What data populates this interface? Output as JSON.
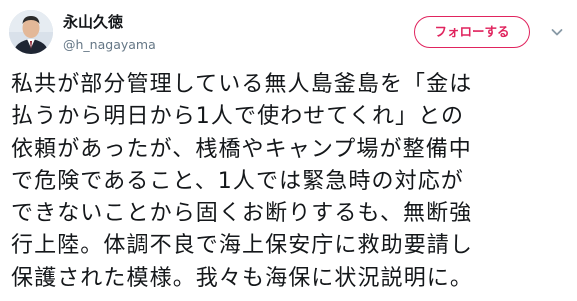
{
  "user": {
    "display_name": "永山久徳",
    "handle": "@h_nagayama"
  },
  "follow_button": {
    "label": "フォローする"
  },
  "icons": {
    "avatar": "avatar-photo",
    "more_menu": "chevron-down-icon"
  },
  "colors": {
    "accent": "#e0245e",
    "text": "#14171a",
    "muted": "#657786"
  },
  "tweet": {
    "lines": [
      "私共が部分管理している無人島釜島を「金は",
      "払うから明日から1人で使わせてくれ」との",
      "依頼があったが、桟橋やキャンプ場が整備中",
      "で危険であること、1人では緊急時の対応が",
      "できないことから固くお断りするも、無断強",
      "行上陸。体調不良で海上保安庁に救助要請し",
      "保護された模様。我々も海保に状況説明に。"
    ]
  }
}
